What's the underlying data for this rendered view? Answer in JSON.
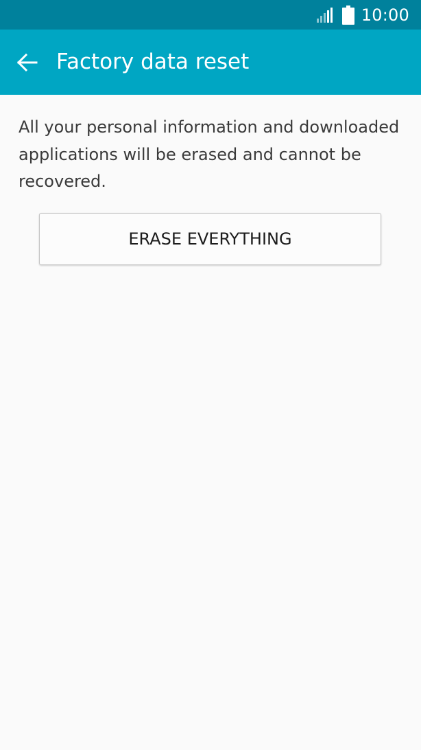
{
  "status_bar": {
    "time": "10:00",
    "signal_icon": "signal-bars-icon",
    "battery_icon": "battery-icon"
  },
  "app_bar": {
    "back_icon": "arrow-left-icon",
    "title": "Factory data reset"
  },
  "main": {
    "description": "All your personal information and downloaded applications will be erased and cannot be recovered.",
    "erase_button_label": "ERASE EVERYTHING"
  },
  "colors": {
    "status_bar": "#00819c",
    "app_bar": "#00a6c3",
    "background": "#fafafa",
    "text": "#3a3a3a"
  }
}
